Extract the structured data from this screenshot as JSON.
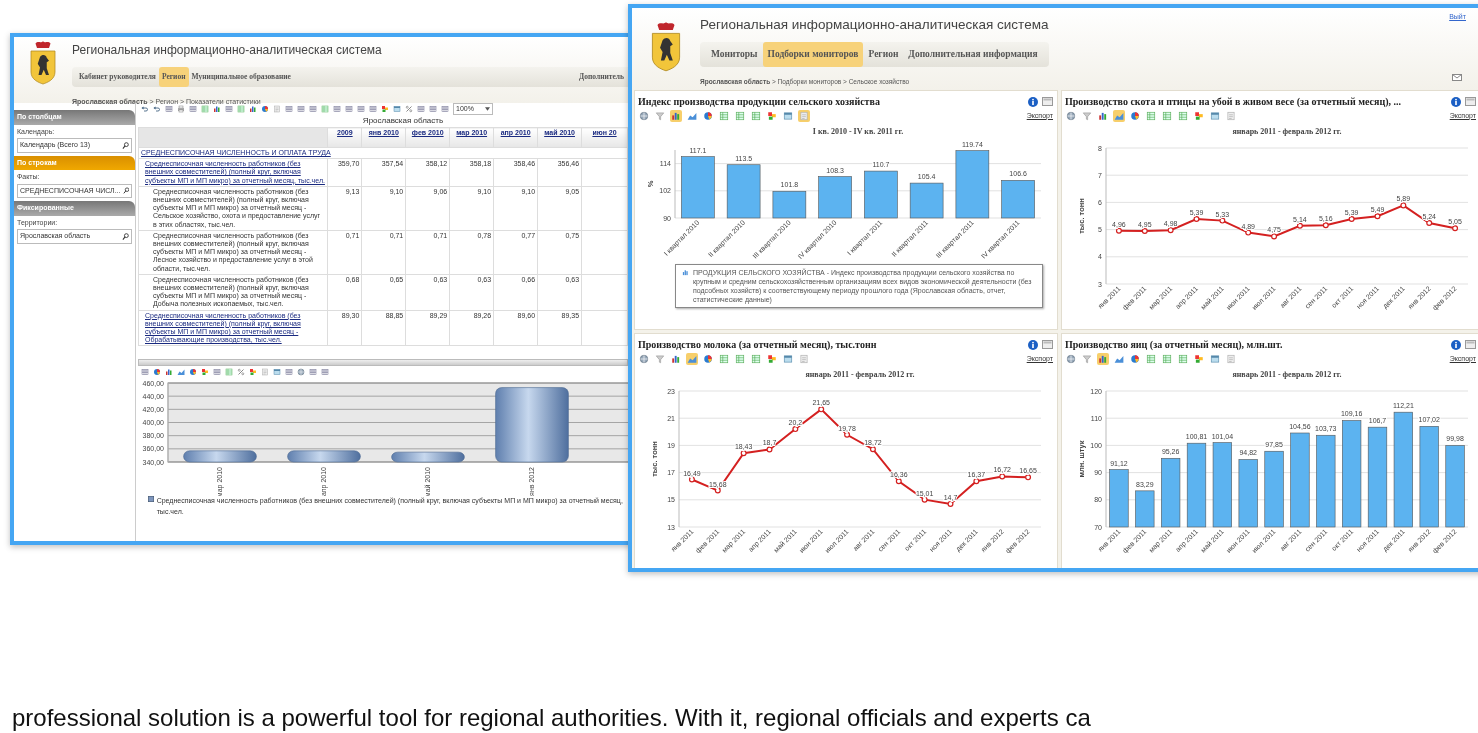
{
  "left_window": {
    "title": "Региональная информационно-аналитическая система",
    "tabs": [
      {
        "label": "Кабинет руководителя",
        "selected": false
      },
      {
        "label": "Регион",
        "selected": true
      },
      {
        "label": "Муниципальное образование",
        "selected": false
      }
    ],
    "tab_cut": "Дополнитель",
    "breadcrumb": "**Ярославская область** > Регион > Показатели статистики",
    "sidebar": [
      {
        "title": "По столбцам",
        "selected": false,
        "field_label": "Календарь:",
        "field_value": "Календарь (Всего 13)"
      },
      {
        "title": "По строкам",
        "selected": true,
        "field_label": "Факты:",
        "field_value": "СРЕДНЕСПИСОЧНАЯ ЧИСЛ..."
      },
      {
        "title": "Фиксированные",
        "selected": false,
        "field_label": "Территории:",
        "field_value": "Ярославская область"
      }
    ],
    "zoom_value": "100%",
    "grid": {
      "title": "Ярославская область",
      "columns": [
        "2009",
        "янв 2010",
        "фев 2010",
        "мар 2010",
        "апр 2010",
        "май 2010",
        "июн 20"
      ],
      "section": "СРЕДНЕСПИСОЧНАЯ ЧИСЛЕННОСТЬ И ОПЛАТА ТРУДА",
      "rows": [
        {
          "label": "Среднесписочная численность работников (без внешних совместителей) (полный круг, включая субъекты МП и МП микро) за отчетный месяц, тыс.чел.",
          "link": true,
          "cells": [
            "359,70",
            "357,54",
            "358,12",
            "358,18",
            "358,46",
            "356,46"
          ]
        },
        {
          "label": "Среднесписочная численность работников (без внешних совместителей) (полный круг, включая субъекты МП и МП микро) за отчетный месяц - Сельское хозяйство, охота и предоставление услуг в этих областях, тыс.чел.",
          "link": false,
          "cells": [
            "9,13",
            "9,10",
            "9,06",
            "9,10",
            "9,10",
            "9,05"
          ]
        },
        {
          "label": "Среднесписочная численность работников (без внешних совместителей) (полный круг, включая субъекты МП и МП микро) за отчетный месяц - Лесное хозяйство и предоставление услуг в этой области, тыс.чел.",
          "link": false,
          "cells": [
            "0,71",
            "0,71",
            "0,71",
            "0,78",
            "0,77",
            "0,75"
          ]
        },
        {
          "label": "Среднесписочная численность работников (без внешних совместителей) (полный круг, включая субъекты МП и МП микро) за отчетный месяц - Добыча полезных ископаемых, тыс.чел.",
          "link": false,
          "cells": [
            "0,68",
            "0,65",
            "0,63",
            "0,63",
            "0,66",
            "0,63"
          ]
        },
        {
          "label": "Среднесписочная численность работников (без внешних совместителей) (полный круг, включая субъекты МП и МП микро) за отчетный месяц - Обрабатывающие производства, тыс.чел.",
          "link": true,
          "cells": [
            "89,30",
            "88,85",
            "89,29",
            "89,26",
            "89,60",
            "89,35"
          ]
        }
      ]
    },
    "chart": {
      "chart_data": {
        "type": "bar",
        "categories": [
          "мар 2010",
          "апр 2010",
          "май 2010",
          "янв 2012"
        ],
        "values": [
          357,
          357,
          355,
          453
        ],
        "ylim": [
          340,
          460
        ],
        "grid": true,
        "yticks": [
          {
            "value": 340,
            "label": "340,00"
          },
          {
            "value": 360,
            "label": "360,00"
          },
          {
            "value": 380,
            "label": "380,00"
          },
          {
            "value": 400,
            "label": "400,00"
          },
          {
            "value": 420,
            "label": "420,00"
          },
          {
            "value": 440,
            "label": "440,00"
          },
          {
            "value": 460,
            "label": "460,00"
          }
        ]
      },
      "legend": "Среднесписочная численность работников (без внешних совместителей) (полный круг, включая субъекты МП и МП микро) за отчетный месяц, тыс.чел."
    }
  },
  "right_window": {
    "title": "Региональная информационно-аналитическая система",
    "logout": "Выйт",
    "tabs": [
      {
        "label": "Мониторы",
        "selected": false
      },
      {
        "label": "Подборки мониторов",
        "selected": true
      },
      {
        "label": "Регион",
        "selected": false
      },
      {
        "label": "Дополнительная информация",
        "selected": false
      }
    ],
    "breadcrumb": "**Ярославская область** > Подборки мониторов > Сельское хозяйство",
    "panels": [
      {
        "title": "Индекс производства продукции сельского хозяйства",
        "export": "Экспорт",
        "toolbar": [
          {
            "kind": "globe",
            "selected": false
          },
          {
            "kind": "funnel",
            "selected": false
          },
          {
            "kind": "bar",
            "selected": true
          },
          {
            "kind": "area",
            "selected": false
          },
          {
            "kind": "pie",
            "selected": false
          },
          {
            "kind": "sheet",
            "selected": false
          },
          {
            "kind": "sheet",
            "selected": false
          },
          {
            "kind": "sheet",
            "selected": false
          },
          {
            "kind": "blocks",
            "selected": false
          },
          {
            "kind": "window",
            "selected": false
          },
          {
            "kind": "note",
            "selected": true
          }
        ],
        "chart_data": {
          "type": "bar",
          "title": "I кв. 2010 - IV кв. 2011 гг.",
          "ylabel": "%",
          "categories": [
            "I квартал 2010",
            "II квартал 2010",
            "III квартал 2010",
            "IV квартал 2010",
            "I квартал 2011",
            "II квартал 2011",
            "III квартал 2011",
            "IV квартал 2011"
          ],
          "values": [
            117.1,
            113.5,
            101.8,
            108.3,
            110.7,
            105.4,
            119.74,
            106.6
          ],
          "ylim": [
            90,
            120
          ],
          "grid": true,
          "yticks": [
            90,
            102,
            114
          ],
          "value_labels": [
            "117.1",
            "113.5",
            "101.8",
            "108.3",
            "110.7",
            "105.4",
            "119.74",
            "106.6"
          ]
        },
        "legend": "ПРОДУКЦИЯ СЕЛЬСКОГО ХОЗЯЙСТВА - Индекс производства продукции сельского хозяйства по крупным и средним сельскохозяйственным организациям всех видов экономической деятельности (без подсобных хозяйств) к соответствующему периоду прошлого года (Ярославская область, отчет, статистические данные)"
      },
      {
        "title": "Производство скота и птицы на убой в живом весе (за отчетный месяц), ...",
        "export": "Экспорт",
        "toolbar": [
          {
            "kind": "globe",
            "selected": false
          },
          {
            "kind": "funnel",
            "selected": false
          },
          {
            "kind": "bar",
            "selected": false
          },
          {
            "kind": "area",
            "selected": true
          },
          {
            "kind": "pie",
            "selected": false
          },
          {
            "kind": "sheet",
            "selected": false
          },
          {
            "kind": "sheet",
            "selected": false
          },
          {
            "kind": "sheet",
            "selected": false
          },
          {
            "kind": "blocks",
            "selected": false
          },
          {
            "kind": "window",
            "selected": false
          },
          {
            "kind": "note",
            "selected": false
          }
        ],
        "chart_data": {
          "type": "line",
          "title": "январь 2011 - февраль 2012 гг.",
          "ylabel": "тыс. тонн",
          "categories": [
            "янв 2011",
            "фев 2011",
            "мар 2011",
            "апр 2011",
            "май 2011",
            "июн 2011",
            "июл 2011",
            "авг 2011",
            "сен 2011",
            "окт 2011",
            "ноя 2011",
            "дек 2011",
            "янв 2012",
            "фев 2012"
          ],
          "values": [
            4.96,
            4.95,
            4.98,
            5.39,
            5.33,
            4.89,
            4.75,
            5.14,
            5.16,
            5.39,
            5.49,
            5.89,
            5.24,
            5.05
          ],
          "ylim": [
            3,
            8
          ],
          "grid": true,
          "marker": "o",
          "yticks": [
            3,
            4,
            5,
            6,
            7,
            8
          ],
          "value_labels": [
            "4,96",
            "4,95",
            "4,98",
            "5,39",
            "5,33",
            "4,89",
            "4,75",
            "5,14",
            "5,16",
            "5,39",
            "5,49",
            "5,89",
            "5,24",
            "5,05"
          ]
        }
      },
      {
        "title": "Производство молока (за отчетный месяц), тыс.тонн",
        "export": "Экспорт",
        "toolbar": [
          {
            "kind": "globe",
            "selected": false
          },
          {
            "kind": "funnel",
            "selected": false
          },
          {
            "kind": "bar",
            "selected": false
          },
          {
            "kind": "area",
            "selected": true
          },
          {
            "kind": "pie",
            "selected": false
          },
          {
            "kind": "sheet",
            "selected": false
          },
          {
            "kind": "sheet",
            "selected": false
          },
          {
            "kind": "sheet",
            "selected": false
          },
          {
            "kind": "blocks",
            "selected": false
          },
          {
            "kind": "window",
            "selected": false
          },
          {
            "kind": "note",
            "selected": false
          }
        ],
        "chart_data": {
          "type": "line",
          "title": "январь 2011 - февраль 2012 гг.",
          "ylabel": "тыс. тонн",
          "categories": [
            "янв 2011",
            "фев 2011",
            "мар 2011",
            "апр 2011",
            "май 2011",
            "июн 2011",
            "июл 2011",
            "авг 2011",
            "сен 2011",
            "окт 2011",
            "ноя 2011",
            "дек 2011",
            "янв 2012",
            "фев 2012"
          ],
          "values": [
            16.49,
            15.68,
            18.43,
            18.7,
            20.2,
            21.65,
            19.78,
            18.72,
            16.36,
            15.01,
            14.7,
            16.37,
            16.72,
            16.65
          ],
          "ylim": [
            13,
            23
          ],
          "grid": true,
          "marker": "o",
          "yticks": [
            13,
            15,
            17,
            19,
            21,
            23
          ],
          "value_labels": [
            "16,49",
            "15,68",
            "18,43",
            "18,7",
            "20,2",
            "21,65",
            "19,78",
            "18,72",
            "16,36",
            "15,01",
            "14,7",
            "16,37",
            "16,72",
            "16,65"
          ]
        }
      },
      {
        "title": "Производство яиц (за отчетный месяц), млн.шт.",
        "export": "Экспорт",
        "toolbar": [
          {
            "kind": "globe",
            "selected": false
          },
          {
            "kind": "funnel",
            "selected": false
          },
          {
            "kind": "bar",
            "selected": true
          },
          {
            "kind": "area",
            "selected": false
          },
          {
            "kind": "pie",
            "selected": false
          },
          {
            "kind": "sheet",
            "selected": false
          },
          {
            "kind": "sheet",
            "selected": false
          },
          {
            "kind": "sheet",
            "selected": false
          },
          {
            "kind": "blocks",
            "selected": false
          },
          {
            "kind": "window",
            "selected": false
          },
          {
            "kind": "note",
            "selected": false
          }
        ],
        "chart_data": {
          "type": "bar",
          "title": "январь 2011 - февраль 2012 гг.",
          "ylabel": "млн. штук",
          "categories": [
            "янв 2011",
            "фев 2011",
            "мар 2011",
            "апр 2011",
            "май 2011",
            "июн 2011",
            "июл 2011",
            "авг 2011",
            "сен 2011",
            "окт 2011",
            "ноя 2011",
            "дек 2011",
            "янв 2012",
            "фев 2012"
          ],
          "values": [
            91.12,
            83.29,
            95.26,
            100.81,
            101.04,
            94.82,
            97.85,
            104.56,
            103.73,
            109.16,
            106.7,
            112.21,
            107.02,
            99.98
          ],
          "ylim": [
            70,
            120
          ],
          "grid": true,
          "yticks": [
            70,
            80,
            90,
            100,
            110,
            120
          ],
          "value_labels": [
            "91,12",
            "83,29",
            "95,26",
            "100,81",
            "101,04",
            "94,82",
            "97,85",
            "104,56",
            "103,73",
            "109,16",
            "106,7",
            "112,21",
            "107,02",
            "99,98"
          ]
        }
      }
    ]
  },
  "caption": "professional solution is a powerful tool for regional authorities. With it, regional officials and experts ca"
}
